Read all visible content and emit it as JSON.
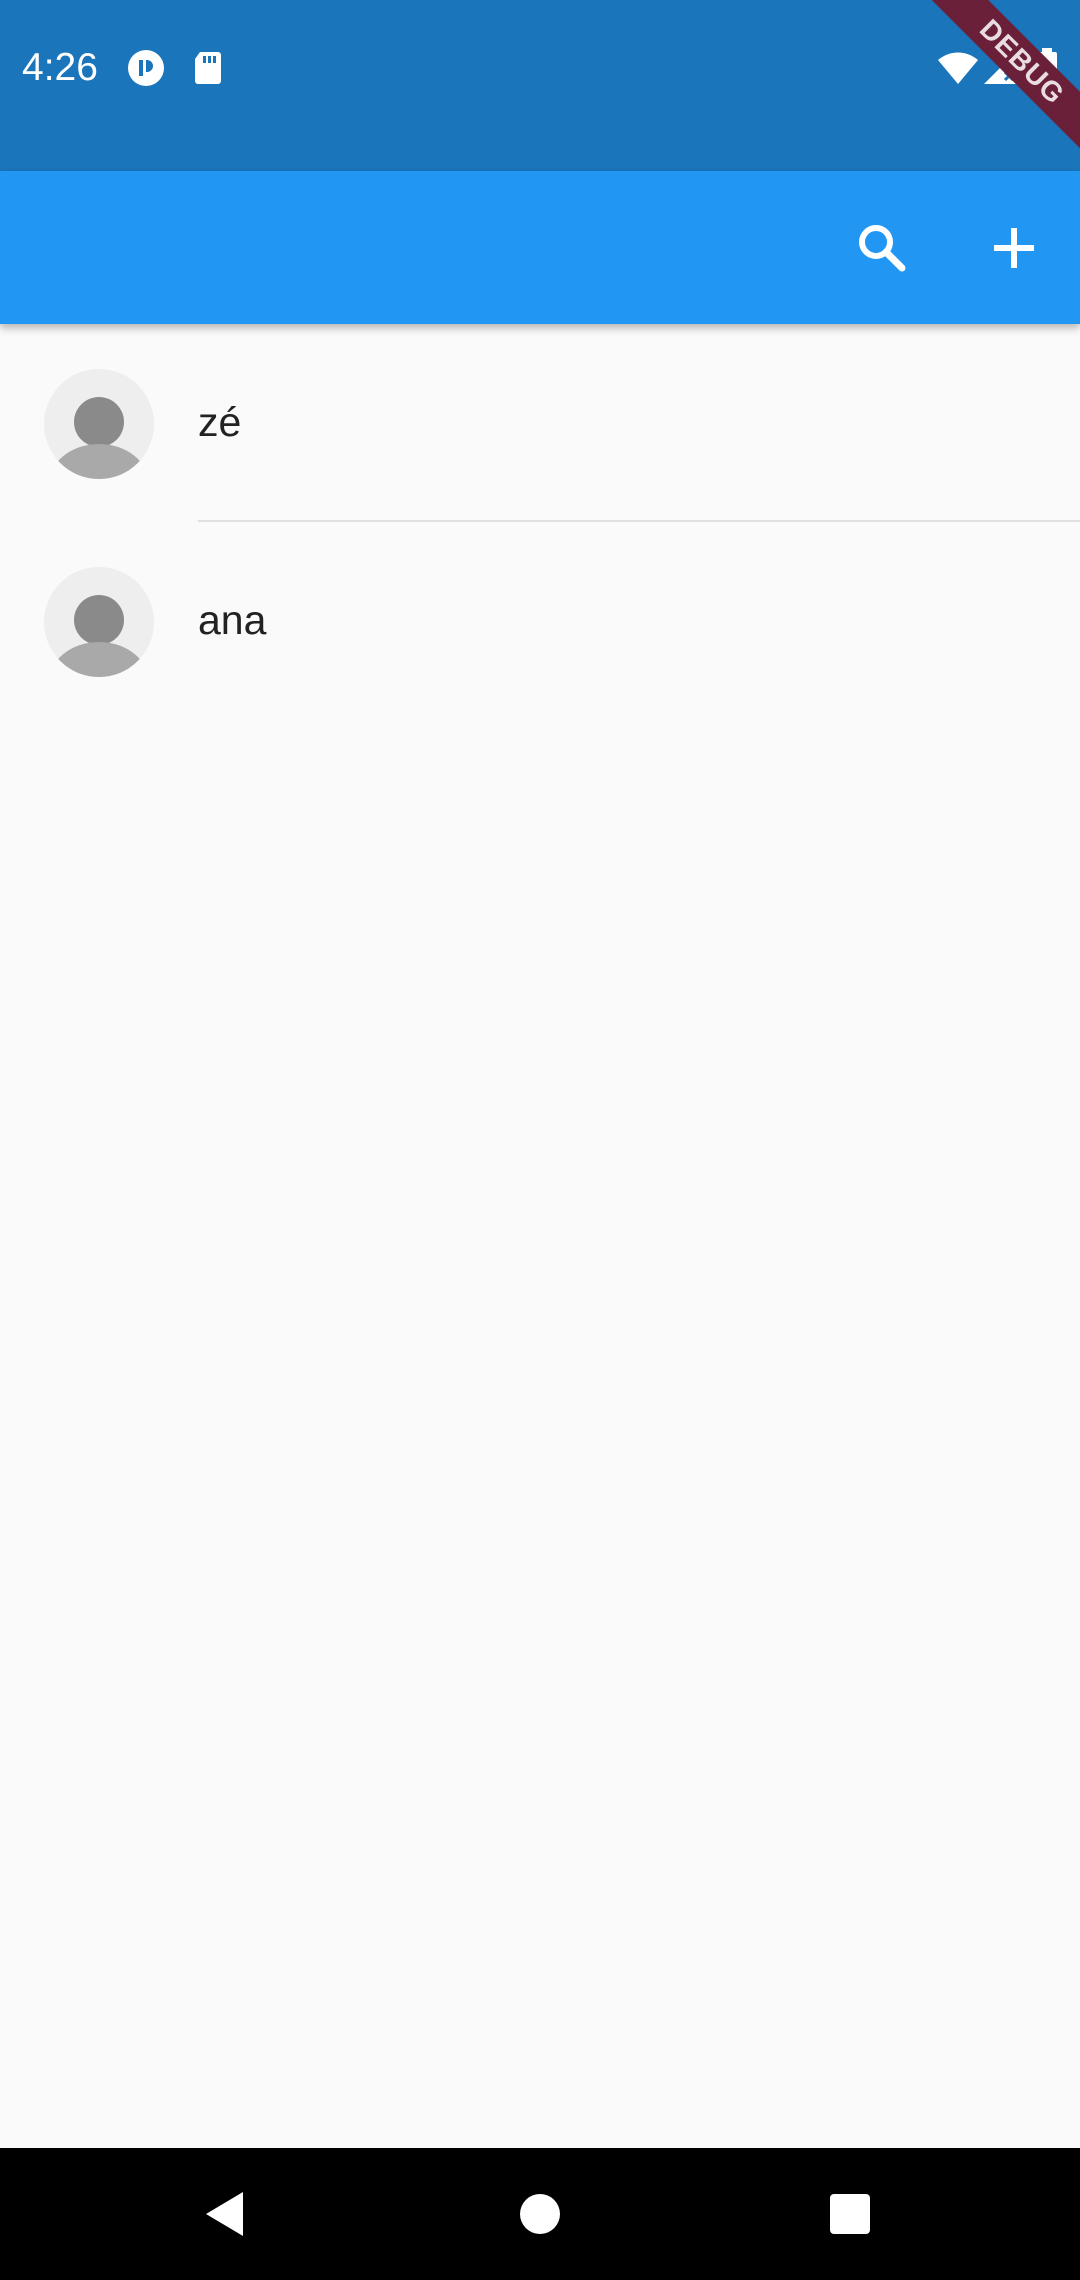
{
  "status_bar": {
    "time": "4:26",
    "left_icons": [
      "pocket-casts-icon",
      "sd-card-icon"
    ],
    "right_icons": [
      "wifi-icon",
      "cellular-signal-icon",
      "battery-icon"
    ]
  },
  "debug_banner": {
    "label": "DEBUG"
  },
  "app_bar": {
    "actions": [
      "search-icon",
      "add-icon"
    ]
  },
  "contacts": [
    {
      "name": "zé",
      "avatar": "default-person-avatar"
    },
    {
      "name": "ana",
      "avatar": "default-person-avatar"
    }
  ],
  "nav_bar": {
    "buttons": [
      "back",
      "home",
      "recents"
    ]
  },
  "colors": {
    "status_bar": "#1b75bb",
    "app_bar": "#2196f3",
    "background": "#fafafa",
    "debug_ribbon": "#6b2039"
  }
}
